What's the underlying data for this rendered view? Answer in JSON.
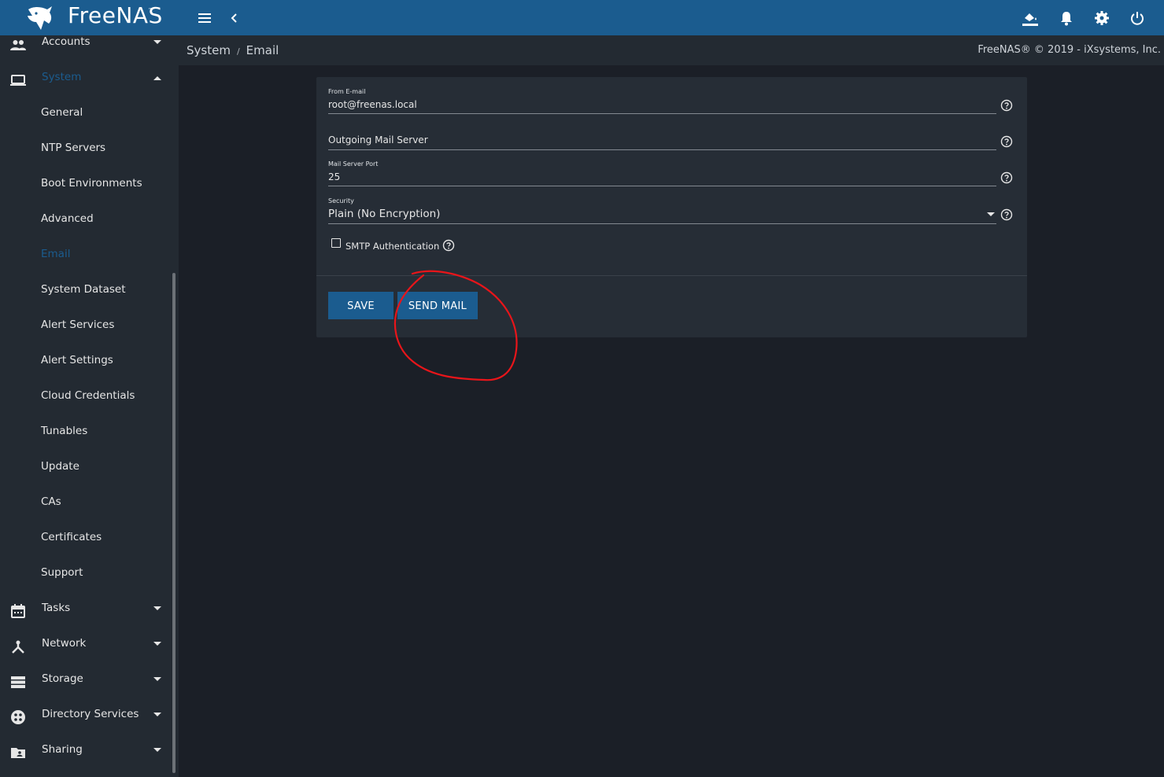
{
  "topbar": {
    "logo_text": "FreeNAS",
    "logo_tm": "™",
    "menu_icon": "hamburger-icon",
    "back_icon": "chevron-left-icon",
    "actions": [
      "theme-paint-icon",
      "bell-icon",
      "gear-icon",
      "power-icon"
    ]
  },
  "breadcrumb": {
    "parent": "System",
    "separator": "/",
    "current": "Email"
  },
  "copyright": "FreeNAS® © 2019 - iXsystems, Inc.",
  "sidebar": {
    "items": [
      {
        "label": "Accounts",
        "icon": "people-icon"
      },
      {
        "label": "System",
        "icon": "laptop-icon"
      },
      {
        "label": "Tasks",
        "icon": "calendar-icon"
      },
      {
        "label": "Network",
        "icon": "network-icon"
      },
      {
        "label": "Storage",
        "icon": "storage-icon"
      },
      {
        "label": "Directory Services",
        "icon": "directory-icon"
      },
      {
        "label": "Sharing",
        "icon": "folder-share-icon"
      }
    ],
    "system_children": [
      "General",
      "NTP Servers",
      "Boot Environments",
      "Advanced",
      "Email",
      "System Dataset",
      "Alert Services",
      "Alert Settings",
      "Cloud Credentials",
      "Tunables",
      "Update",
      "CAs",
      "Certificates",
      "Support"
    ],
    "active_child": "Email"
  },
  "form": {
    "from_email": {
      "label": "From E-mail",
      "value": "root@freenas.local"
    },
    "mail_server": {
      "placeholder": "Outgoing Mail Server",
      "value": ""
    },
    "port": {
      "label": "Mail Server Port",
      "value": "25"
    },
    "security": {
      "label": "Security",
      "value": "Plain (No Encryption)"
    },
    "smtp_auth": {
      "label": "SMTP Authentication",
      "checked": false
    },
    "save_label": "SAVE",
    "send_mail_label": "SEND MAIL"
  },
  "colors": {
    "primary": "#1b5c8f",
    "background": "#1b1f27",
    "panel": "#262d36",
    "annotation": "#e8151a"
  }
}
